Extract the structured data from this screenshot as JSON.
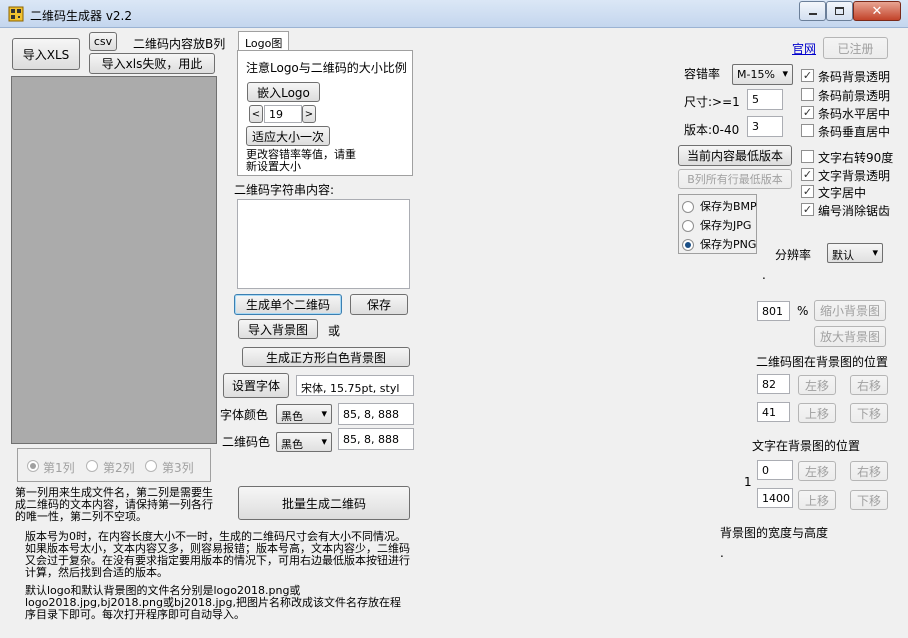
{
  "window": {
    "title": "二维码生成器 v2.2"
  },
  "left": {
    "import_xls": "导入XLS",
    "csv": "csv",
    "content_col_note": "二维码内容放B列",
    "import_fail": "导入xls失败，用此",
    "col1": "第1列",
    "col2": "第2列",
    "col3": "第3列",
    "note1": "第一列用来生成文件名，第二列是需要生成二维码的文本内容，请保持第一列各行的唯一性，第二列不空项。"
  },
  "logo": {
    "tab": "Logo图",
    "note": "注意Logo与二维码的大小比例",
    "embed": "嵌入Logo",
    "size_value": "19",
    "fit_size": "适应大小一次",
    "change_note": "更改容错率等值，请重新设置大小"
  },
  "center": {
    "content_label": "二维码字符串内容:",
    "gen_single": "生成单个二维码",
    "save": "保存",
    "import_bg": "导入背景图",
    "or": "或",
    "gen_white_bg": "生成正方形白色背景图",
    "set_font": "设置字体",
    "font_value": "宋体, 15.75pt, styl",
    "text_color_label": "字体颜色",
    "text_color_select": "黑色",
    "text_color_value": "85, 8, 888",
    "qr_color_label": "二维码色",
    "qr_color_select": "黑色",
    "qr_color_value": "85, 8, 888",
    "batch": "批量生成二维码"
  },
  "notes": {
    "version_note": "版本号为0时，在内容长度大小不一时，生成的二维码尺寸会有大小不同情况。如果版本号太小，文本内容又多，则容易报错；版本号高，文本内容少，二维码又会过于复杂。在没有要求指定要用版本的情况下，可用右边最低版本按钮进行计算，然后找到合适的版本。",
    "default_note": "默认logo和默认背景图的文件名分别是logo2018.png或logo2018.jpg,bj2018.png或bj2018.jpg,把图片名称改成该文件名存放在程序目录下即可。每次打开程序即可自动导入。"
  },
  "right": {
    "website": "官网",
    "registered": "已注册",
    "ec_label": "容错率",
    "ec_value": "M-15%",
    "size_label": "尺寸:>=1",
    "size_value": "5",
    "version_label": "版本:0-40",
    "version_value": "3",
    "min_version": "当前内容最低版本",
    "b_min_version": "B列所有行最低版本",
    "save_bmp": "保存为BMP",
    "save_jpg": "保存为JPG",
    "save_png": "保存为PNG",
    "cb_bg_transparent": "条码背景透明",
    "cb_fg_transparent": "条码前景透明",
    "cb_h_center": "条码水平居中",
    "cb_v_center": "条码垂直居中",
    "cb_rotate": "文字右转90度",
    "cb_text_bg": "文字背景透明",
    "cb_text_center": "文字居中",
    "cb_antialias": "编号消除锯齿",
    "resolution_label": "分辨率",
    "resolution_value": "默认",
    "dot1": ".",
    "scale_value": "801",
    "percent": "%",
    "shrink_bg": "缩小背景图",
    "enlarge_bg": "放大背景图",
    "qr_pos_label": "二维码图在背景图的位置",
    "qr_x": "82",
    "left_move": "左移",
    "right_move": "右移",
    "qr_y": "41",
    "up_move": "上移",
    "down_move": "下移",
    "text_pos_label": "文字在背景图的位置",
    "one": "1",
    "text_x": "0",
    "text_y": "1400",
    "bg_size_label": "背景图的宽度与高度",
    "dot2": "."
  },
  "colors": {
    "titlebar": "#c4d6ee",
    "preview_gray": "#ababab",
    "link": "#0000cc"
  }
}
